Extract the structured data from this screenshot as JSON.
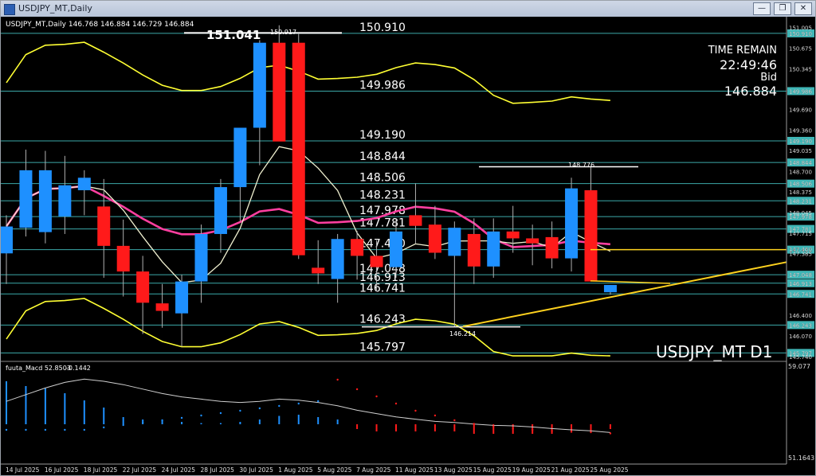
{
  "window": {
    "title": "USDJPY_MT,Daily",
    "minimize_glyph": "—",
    "restore_glyph": "❐",
    "close_glyph": "✕"
  },
  "header": {
    "symbol_info": "USDJPY_MT,Daily  146.768 146.884 146.729 146.884",
    "peak_label": "151.041",
    "peak_small_label": "150.917",
    "high_label": "148.776",
    "low_label": "146.214"
  },
  "info_panel": {
    "time_remain_label": "TIME REMAIN",
    "time_remain_value": "22:49:46",
    "bid_label": "Bid",
    "bid_value": "146.884"
  },
  "watermark": "USDJPY_MT D1",
  "indicator": {
    "label": "fuuta_Macd 52.8503",
    "value2": "-0.1442",
    "scale_top": "59.077",
    "scale_bottom": "51.1643"
  },
  "levels": [
    150.91,
    149.986,
    149.19,
    148.844,
    148.506,
    148.231,
    147.978,
    147.781,
    147.45,
    147.048,
    146.913,
    146.741,
    146.243,
    145.797
  ],
  "price_axis": {
    "labels": [
      "151.005",
      "150.910",
      "150.675",
      "150.345",
      "149.986",
      "149.690",
      "149.360",
      "149.190",
      "149.035",
      "148.844",
      "148.700",
      "148.506",
      "148.375",
      "148.231",
      "148.045",
      "147.978",
      "147.781",
      "147.715",
      "147.460",
      "147.385",
      "147.048",
      "146.913",
      "146.741",
      "146.400",
      "146.243",
      "146.070",
      "145.797",
      "145.740"
    ]
  },
  "date_axis": [
    "14 Jul 2025",
    "16 Jul 2025",
    "18 Jul 2025",
    "22 Jul 2025",
    "24 Jul 2025",
    "28 Jul 2025",
    "30 Jul 2025",
    "1 Aug 2025",
    "5 Aug 2025",
    "7 Aug 2025",
    "11 Aug 2025",
    "13 Aug 2025",
    "15 Aug 2025",
    "19 Aug 2025",
    "21 Aug 2025",
    "25 Aug 2025"
  ],
  "colors": {
    "bull": "#1e90ff",
    "bear": "#ff1a1a",
    "level_line": "#47c7c7",
    "band": "#ffff33",
    "ma_white": "#f0f0d0",
    "ma_pink": "#ff3fa0",
    "trend": "#ffd21e"
  },
  "chart_data": {
    "type": "candlestick",
    "title": "USDJPY_MT,Daily",
    "x": [
      "11 Jul",
      "14 Jul",
      "15 Jul",
      "16 Jul",
      "17 Jul",
      "18 Jul",
      "21 Jul",
      "22 Jul",
      "23 Jul",
      "24 Jul",
      "25 Jul",
      "28 Jul",
      "29 Jul",
      "30 Jul",
      "31 Jul",
      "1 Aug",
      "4 Aug",
      "5 Aug",
      "6 Aug",
      "7 Aug",
      "8 Aug",
      "11 Aug",
      "12 Aug",
      "13 Aug",
      "14 Aug",
      "15 Aug",
      "18 Aug",
      "19 Aug",
      "20 Aug",
      "21 Aug",
      "22 Aug",
      "25 Aug"
    ],
    "candles": [
      {
        "o": 147.39,
        "h": 148.0,
        "l": 146.9,
        "c": 147.82
      },
      {
        "o": 147.8,
        "h": 149.05,
        "l": 147.66,
        "c": 148.72
      },
      {
        "o": 147.73,
        "h": 149.03,
        "l": 147.55,
        "c": 148.72
      },
      {
        "o": 147.98,
        "h": 148.95,
        "l": 147.7,
        "c": 148.48
      },
      {
        "o": 148.4,
        "h": 148.72,
        "l": 148.0,
        "c": 148.6
      },
      {
        "o": 148.14,
        "h": 148.58,
        "l": 147.0,
        "c": 147.51
      },
      {
        "o": 147.51,
        "h": 147.93,
        "l": 146.7,
        "c": 147.1
      },
      {
        "o": 147.1,
        "h": 147.35,
        "l": 146.1,
        "c": 146.6
      },
      {
        "o": 146.59,
        "h": 146.9,
        "l": 146.2,
        "c": 146.47
      },
      {
        "o": 146.43,
        "h": 147.05,
        "l": 145.9,
        "c": 146.94
      },
      {
        "o": 146.94,
        "h": 147.85,
        "l": 146.6,
        "c": 147.7
      },
      {
        "o": 147.7,
        "h": 148.58,
        "l": 147.4,
        "c": 148.45
      },
      {
        "o": 148.45,
        "h": 149.3,
        "l": 147.9,
        "c": 149.4
      },
      {
        "o": 149.4,
        "h": 150.8,
        "l": 148.8,
        "c": 150.76
      },
      {
        "o": 150.76,
        "h": 151.04,
        "l": 149.3,
        "c": 149.18
      },
      {
        "o": 150.76,
        "h": 150.9,
        "l": 147.3,
        "c": 147.36
      },
      {
        "o": 147.16,
        "h": 147.6,
        "l": 146.9,
        "c": 147.07
      },
      {
        "o": 146.98,
        "h": 147.7,
        "l": 146.6,
        "c": 147.62
      },
      {
        "o": 147.62,
        "h": 147.75,
        "l": 146.97,
        "c": 147.35
      },
      {
        "o": 147.35,
        "h": 147.6,
        "l": 146.78,
        "c": 147.17
      },
      {
        "o": 147.17,
        "h": 147.95,
        "l": 147.0,
        "c": 147.74
      },
      {
        "o": 148.0,
        "h": 148.51,
        "l": 147.55,
        "c": 147.83
      },
      {
        "o": 147.85,
        "h": 148.15,
        "l": 147.3,
        "c": 147.4
      },
      {
        "o": 147.35,
        "h": 147.9,
        "l": 146.21,
        "c": 147.8
      },
      {
        "o": 147.7,
        "h": 147.95,
        "l": 146.9,
        "c": 147.18
      },
      {
        "o": 147.18,
        "h": 147.95,
        "l": 147.0,
        "c": 147.74
      },
      {
        "o": 147.74,
        "h": 148.15,
        "l": 147.4,
        "c": 147.63
      },
      {
        "o": 147.63,
        "h": 147.85,
        "l": 147.2,
        "c": 147.55
      },
      {
        "o": 147.65,
        "h": 147.9,
        "l": 147.15,
        "c": 147.31
      },
      {
        "o": 147.31,
        "h": 148.6,
        "l": 147.1,
        "c": 148.43
      },
      {
        "o": 148.4,
        "h": 148.776,
        "l": 146.95,
        "c": 146.94
      },
      {
        "o": 146.768,
        "h": 146.884,
        "l": 146.729,
        "c": 146.884
      }
    ],
    "ylim": [
      145.7,
      151.1
    ],
    "macd_hist": [
      1.8,
      1.6,
      1.5,
      1.3,
      1.0,
      0.7,
      0.3,
      0.2,
      0.15,
      0.1,
      0.05,
      0.05,
      0.1,
      0.2,
      0.35,
      0.4,
      0.3,
      0.2,
      -0.2,
      -0.3,
      -0.3,
      -0.3,
      -0.3,
      -0.3,
      -0.4,
      -0.4,
      -0.4,
      -0.4,
      -0.4,
      -0.35,
      -0.3,
      -0.2
    ],
    "macd_signal": [
      0.6,
      0.9,
      1.2,
      1.45,
      1.6,
      1.5,
      1.35,
      1.15,
      0.95,
      0.8,
      0.7,
      0.6,
      0.55,
      0.6,
      0.7,
      0.65,
      0.55,
      0.4,
      0.2,
      0.05,
      -0.1,
      -0.2,
      -0.3,
      -0.35,
      -0.42,
      -0.48,
      -0.5,
      -0.55,
      -0.62,
      -0.68,
      -0.72,
      -0.8
    ],
    "macd_dots": [
      0.2,
      0.2,
      0.2,
      0.2,
      0.2,
      0.3,
      0.4,
      0.5,
      0.6,
      0.7,
      0.8,
      0.9,
      1.0,
      1.1,
      1.2,
      1.3,
      1.4,
      2.3,
      1.9,
      1.6,
      1.3,
      1.0,
      0.8,
      0.6,
      0.45,
      0.35,
      0.25,
      0.2,
      0.15,
      0.12,
      0.1,
      0.05
    ]
  }
}
